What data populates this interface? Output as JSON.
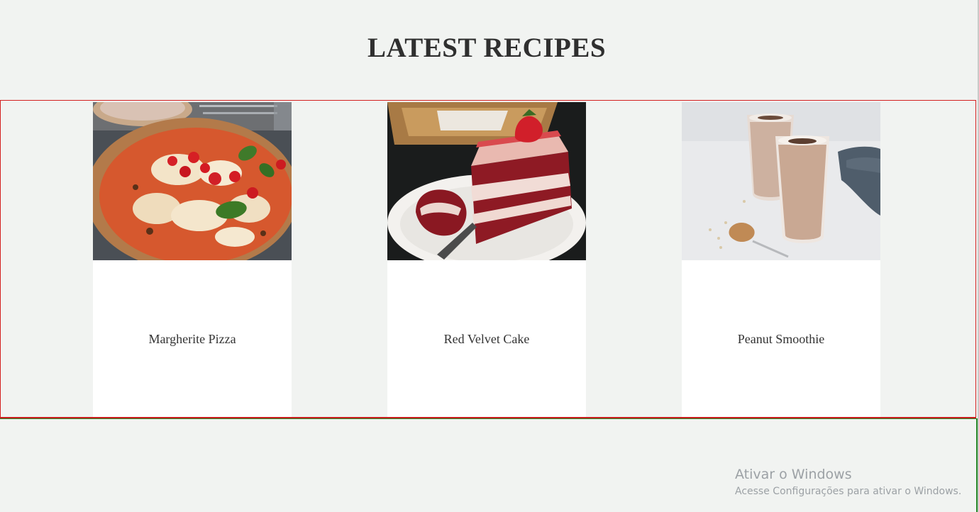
{
  "section": {
    "title": "LATEST RECIPES"
  },
  "recipes": [
    {
      "name": "Margherite Pizza",
      "image": "pizza-photo"
    },
    {
      "name": "Red Velvet Cake",
      "image": "cake-photo"
    },
    {
      "name": "Peanut Smoothie",
      "image": "smoothie-photo"
    }
  ],
  "watermark": {
    "title": "Ativar o Windows",
    "subtitle": "Acesse Configurações para ativar o Windows."
  },
  "colors": {
    "background": "#f1f3f1",
    "card": "#ffffff",
    "container_outline": "#d42020",
    "footer_outline": "#2a8a2a",
    "title_text": "#2f2f2f"
  }
}
